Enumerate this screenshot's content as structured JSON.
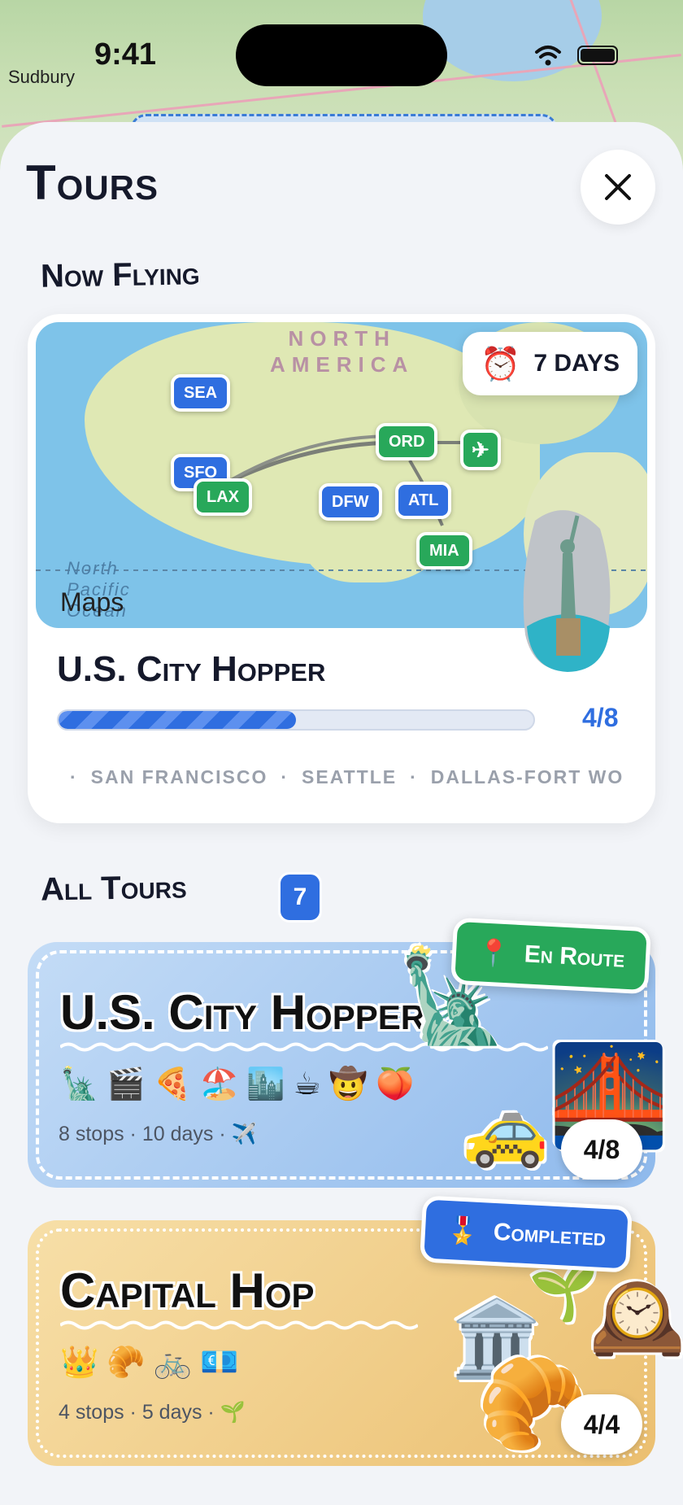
{
  "status": {
    "time": "9:41",
    "location_label": "Sudbury"
  },
  "header": {
    "title": "Tours",
    "close_icon": "close-icon"
  },
  "now_flying": {
    "section_title": "Now Flying",
    "duration_label": "7 DAYS",
    "map": {
      "region_label_line1": "NORTH",
      "region_label_line2": "AMERICA",
      "ocean_label": "North Pacific Ocean",
      "attribution": "Maps",
      "airports": [
        "SEA",
        "SFO",
        "LAX",
        "DFW",
        "ORD",
        "ATL",
        "MIA"
      ]
    },
    "tour_name": "U.S. City Hopper",
    "progress": {
      "completed": 4,
      "total": 8,
      "label": "4/8"
    },
    "cities": [
      "SAN FRANCISCO",
      "SEATTLE",
      "DALLAS-FORT WO"
    ]
  },
  "all_tours": {
    "section_title": "All Tours",
    "count": "7",
    "tours": [
      {
        "name": "U.S. City Hopper",
        "emojis": "🗽🎬🍕🏖️🏙️☕🤠🍑",
        "meta": "8 stops · 10 days · ✈️",
        "status": "En Route",
        "score": "4/8",
        "color": "#9cc4f0"
      },
      {
        "name": "Capital Hop",
        "emojis": "👑🥐🚲💶",
        "meta": "4 stops · 5 days · 🌱",
        "status": "Completed",
        "score": "4/4",
        "color": "#f2cf8a"
      }
    ]
  },
  "colors": {
    "accent": "#2f6ee0",
    "green": "#28a85a",
    "ink": "#15192b"
  }
}
